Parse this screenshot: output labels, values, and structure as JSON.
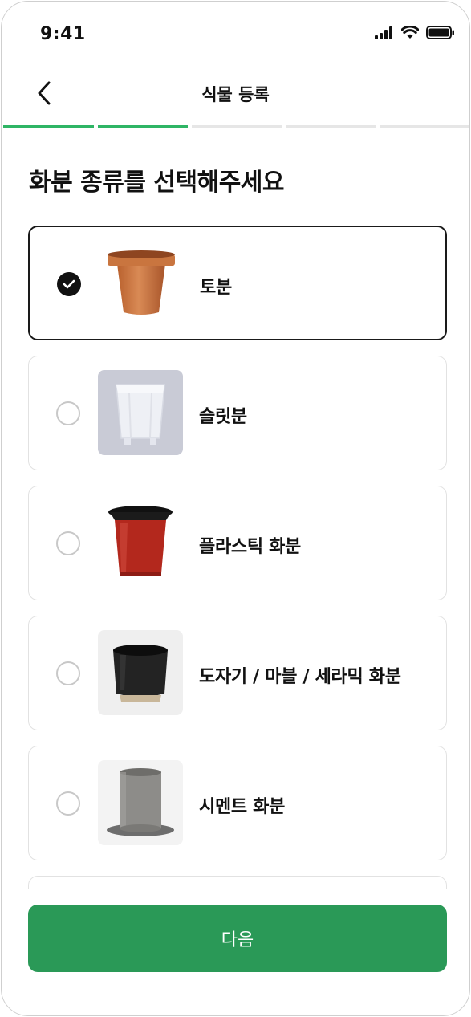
{
  "status_bar": {
    "time": "9:41"
  },
  "header": {
    "title": "식물 등록"
  },
  "progress": {
    "total_steps": 5,
    "completed_steps": 2
  },
  "heading": "화분 종류를 선택해주세요",
  "options": [
    {
      "label": "토분",
      "icon": "terracotta-pot-icon",
      "selected": true
    },
    {
      "label": "슬릿분",
      "icon": "slit-pot-icon",
      "selected": false
    },
    {
      "label": "플라스틱 화분",
      "icon": "plastic-pot-icon",
      "selected": false
    },
    {
      "label": "도자기 / 마블 / 세라믹 화분",
      "icon": "ceramic-pot-icon",
      "selected": false
    },
    {
      "label": "시멘트 화분",
      "icon": "cement-pot-icon",
      "selected": false
    }
  ],
  "next_button": {
    "label": "다음"
  },
  "colors": {
    "accent": "#2fb565",
    "button": "#2a9957",
    "selected_border": "#1a1a1a"
  }
}
